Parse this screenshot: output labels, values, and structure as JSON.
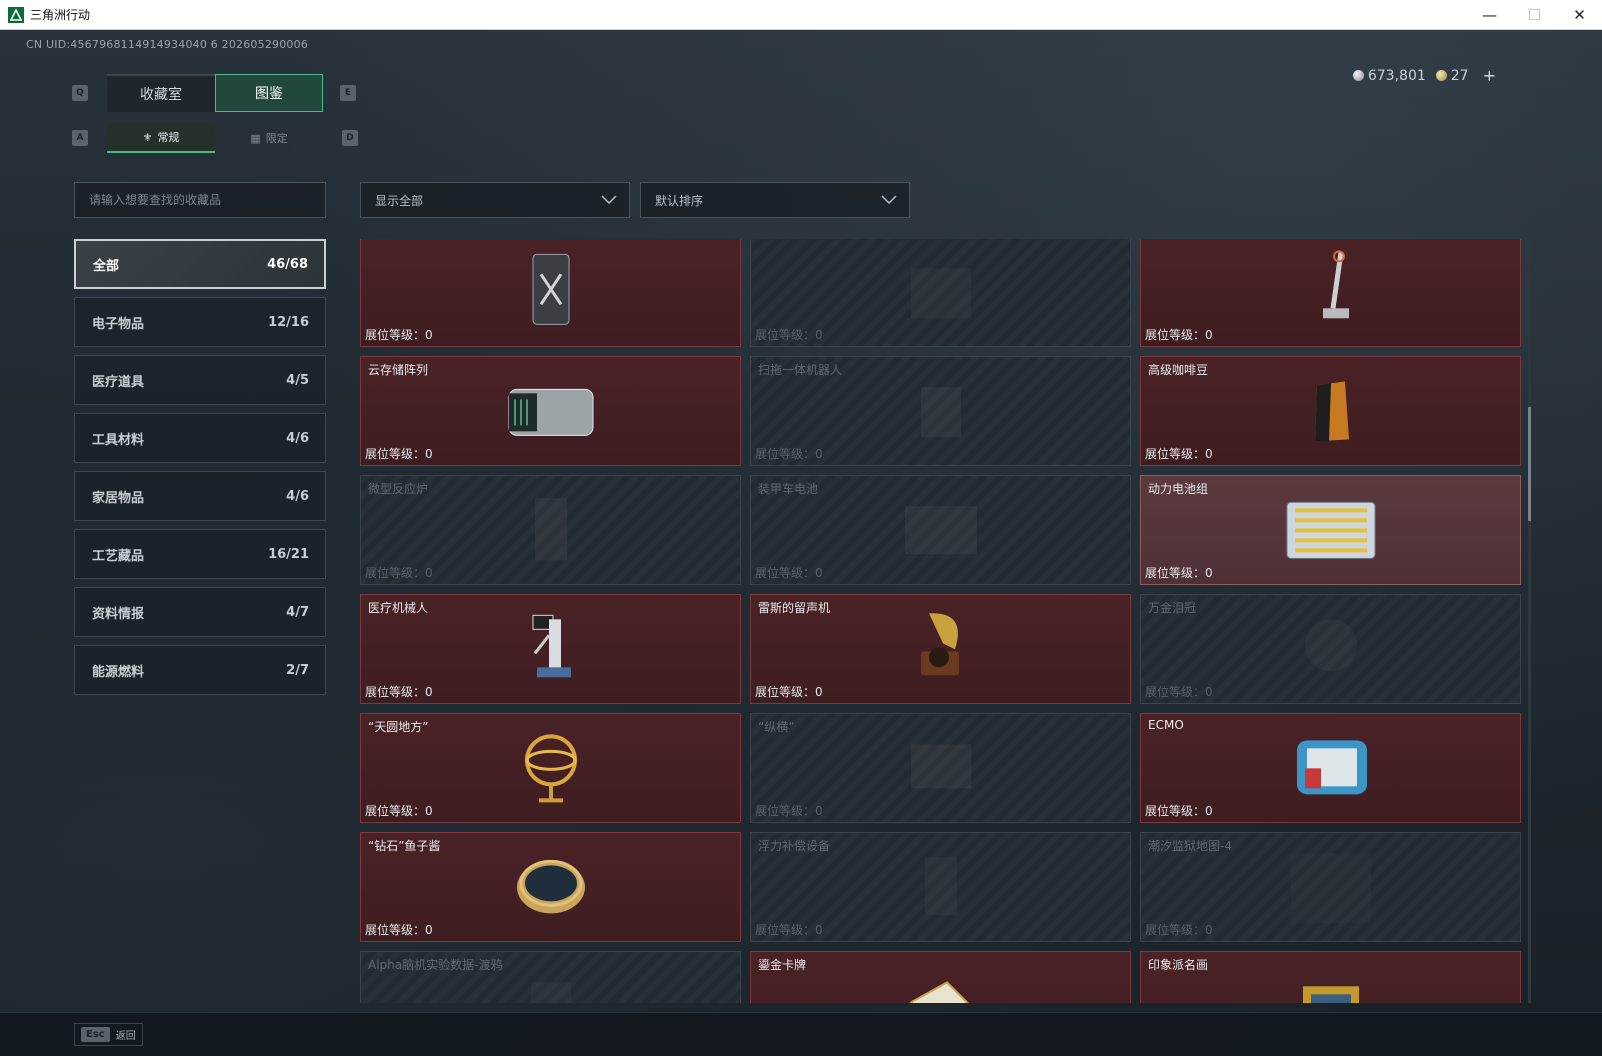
{
  "window": {
    "title": "三角洲行动",
    "controls": [
      "minimize",
      "maximize",
      "close"
    ]
  },
  "header": {
    "uid": "CN UID:4567968114914934040 6 202605290006",
    "currency_silver": "673,801",
    "currency_gold": "27",
    "currency_add": "+"
  },
  "tabs": {
    "main": [
      {
        "label": "收藏室",
        "active": false
      },
      {
        "label": "图鉴",
        "active": true
      }
    ],
    "main_key_left": "Q",
    "main_key_right": "E",
    "sub": [
      {
        "label": "常规",
        "active": true
      },
      {
        "label": "限定",
        "active": false
      }
    ],
    "sub_key_left": "A",
    "sub_key_right": "D"
  },
  "search": {
    "placeholder": "请输入想要查找的收藏品"
  },
  "filters": {
    "display": "显示全部",
    "sort": "默认排序"
  },
  "categories": [
    {
      "label": "全部",
      "count": "46/68",
      "active": true
    },
    {
      "label": "电子物品",
      "count": "12/16"
    },
    {
      "label": "医疗道具",
      "count": "4/5"
    },
    {
      "label": "工具材料",
      "count": "4/6"
    },
    {
      "label": "家居物品",
      "count": "4/6"
    },
    {
      "label": "工艺藏品",
      "count": "16/21"
    },
    {
      "label": "资料情报",
      "count": "4/7"
    },
    {
      "label": "能源燃料",
      "count": "2/7"
    }
  ],
  "items": [
    {
      "name": "",
      "level": "展位等级：0",
      "locked": false,
      "icon": "jerrycan-icon"
    },
    {
      "name": "",
      "level": "展位等级：0",
      "locked": true,
      "icon": "machine-icon"
    },
    {
      "name": "",
      "level": "展位等级：0",
      "locked": false,
      "icon": "vacuum-icon"
    },
    {
      "name": "云存储阵列",
      "level": "展位等级：0",
      "locked": false,
      "icon": "storage-array-icon"
    },
    {
      "name": "扫拖一体机器人",
      "level": "展位等级：0",
      "locked": true,
      "icon": "robot-vacuum-icon"
    },
    {
      "name": "高级咖啡豆",
      "level": "展位等级：0",
      "locked": false,
      "icon": "coffee-bag-icon"
    },
    {
      "name": "微型反应炉",
      "level": "展位等级：0",
      "locked": true,
      "icon": "reactor-icon"
    },
    {
      "name": "装甲车电池",
      "level": "展位等级：0",
      "locked": true,
      "icon": "battery-icon"
    },
    {
      "name": "动力电池组",
      "level": "展位等级：0",
      "locked": false,
      "highlight": true,
      "icon": "battery-pack-icon"
    },
    {
      "name": "医疗机械人",
      "level": "展位等级：0",
      "locked": false,
      "icon": "medical-robot-icon"
    },
    {
      "name": "雷斯的留声机",
      "level": "展位等级：0",
      "locked": false,
      "icon": "gramophone-icon"
    },
    {
      "name": "万金泪冠",
      "level": "展位等级：0",
      "locked": true,
      "icon": "crown-icon"
    },
    {
      "name": "“天圆地方”",
      "level": "展位等级：0",
      "locked": false,
      "icon": "armillary-icon"
    },
    {
      "name": "“纵横”",
      "level": "展位等级：0",
      "locked": true,
      "icon": "chessboard-icon"
    },
    {
      "name": "ECMO",
      "level": "展位等级：0",
      "locked": false,
      "icon": "ecmo-icon"
    },
    {
      "name": "“钻石”鱼子酱",
      "level": "展位等级：0",
      "locked": false,
      "icon": "caviar-tin-icon"
    },
    {
      "name": "浮力补偿设备",
      "level": "展位等级：0",
      "locked": true,
      "icon": "buoyancy-icon"
    },
    {
      "name": "潮汐监狱地图-4",
      "level": "展位等级：0",
      "locked": true,
      "icon": "map-icon"
    },
    {
      "name": "Alpha脑机实验数据-渡鸦",
      "level": "",
      "locked": true,
      "icon": "data-icon"
    },
    {
      "name": "鎏金卡牌",
      "level": "",
      "locked": false,
      "icon": "card-icon"
    },
    {
      "name": "印象派名画",
      "level": "",
      "locked": false,
      "icon": "painting-icon"
    }
  ],
  "footer": {
    "esc_key": "Esc",
    "esc_label": "返回"
  },
  "colors": {
    "owned_card": "#4a2226",
    "locked_card": "#222b31",
    "accent_green": "#4cb88c"
  }
}
